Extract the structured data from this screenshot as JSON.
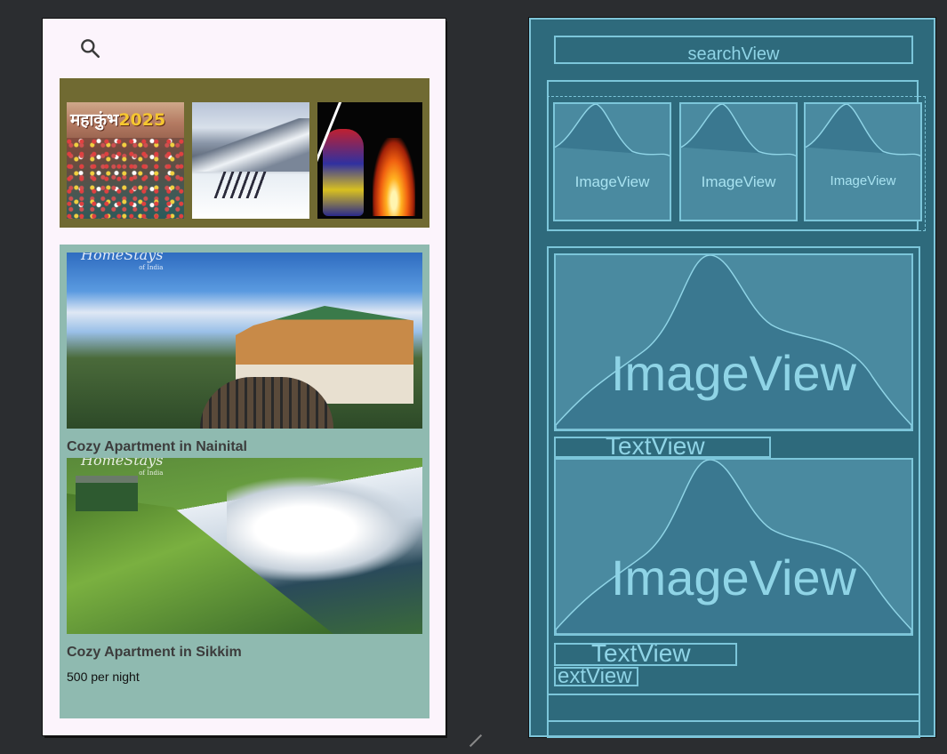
{
  "design": {
    "search": {
      "icon": "search-icon"
    },
    "banners": [
      {
        "title_main": "महाकुंभ",
        "title_year": "2025"
      },
      {
        "title_main": "",
        "title_year": ""
      },
      {
        "title_main": "",
        "title_year": ""
      }
    ],
    "listings": [
      {
        "title": "Cozy Apartment in Nainital",
        "watermark": "HomeStays",
        "watermark_sub": "of India"
      },
      {
        "title": "Cozy Apartment in Sikkim",
        "price": "500 per night",
        "watermark": "HomeStays",
        "watermark_sub": "of India"
      }
    ],
    "colors": {
      "background": "#fcf4fc",
      "banner_strip": "#706a32",
      "listing_panel": "#8fbab0"
    }
  },
  "blueprint": {
    "search_label": "searchView",
    "thumb_labels": [
      "ImageView",
      "ImageView",
      "ImageView"
    ],
    "big_image_labels": [
      "ImageView",
      "ImageView"
    ],
    "text_labels": [
      "TextView",
      "TextView",
      "extView"
    ],
    "colors": {
      "background": "#2e6a7c",
      "outline": "#7cc6da"
    }
  }
}
